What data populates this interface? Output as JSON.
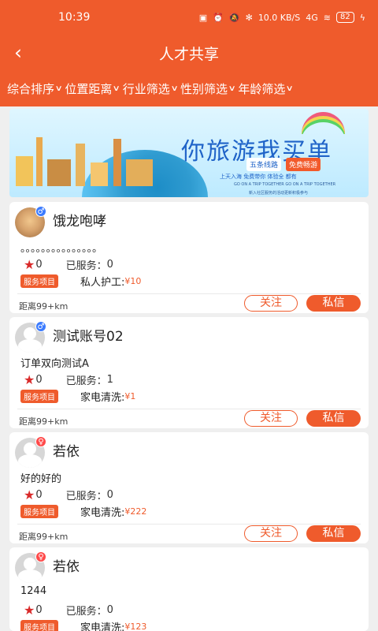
{
  "status_bar": {
    "time": "10:39",
    "network_speed": "10.0 KB/S",
    "signal": "4G",
    "battery": "82"
  },
  "header": {
    "title": "人才共享",
    "back_icon": "chevron-left-icon"
  },
  "filters": [
    {
      "label": "综合排序"
    },
    {
      "label": "位置距离"
    },
    {
      "label": "行业筛选"
    },
    {
      "label": "性别筛选"
    },
    {
      "label": "年龄筛选"
    }
  ],
  "banner": {
    "headline": "你旅游我买单",
    "tag1": "五条线路",
    "tag2": "免费畅游",
    "subline": "上天入海 免费带你 体验全 都有",
    "small_line": "GO ON A TRIP TOGETHER GO ON A TRIP TOGETHER",
    "tiny_line": "新入社区服务的活动更新积极参与"
  },
  "cards": [
    {
      "name": "饿龙咆哮",
      "gender": "male",
      "gender_symbol": "♂",
      "intro": "。。。。。。。。。。。。。。。",
      "rating": "0",
      "served_label": "已服务：",
      "served": "0",
      "service_tag": "服务项目",
      "service_name": "私人护工:",
      "price": "¥10",
      "distance": "距离99+km",
      "follow_label": "关注",
      "message_label": "私信",
      "avatar": "dog"
    },
    {
      "name": "测试账号02",
      "gender": "male",
      "gender_symbol": "♂",
      "intro": "订单双向测试A",
      "rating": "0",
      "served_label": "已服务：",
      "served": "1",
      "service_tag": "服务项目",
      "service_name": "家电清洗:",
      "price": "¥1",
      "distance": "距离99+km",
      "follow_label": "关注",
      "message_label": "私信",
      "avatar": "default"
    },
    {
      "name": "若依",
      "gender": "female",
      "gender_symbol": "♀",
      "intro": "好的好的",
      "rating": "0",
      "served_label": "已服务：",
      "served": "0",
      "service_tag": "服务项目",
      "service_name": "家电清洗:",
      "price": "¥222",
      "distance": "距离99+km",
      "follow_label": "关注",
      "message_label": "私信",
      "avatar": "default"
    },
    {
      "name": "若依",
      "gender": "female",
      "gender_symbol": "♀",
      "intro": "1244",
      "rating": "0",
      "served_label": "已服务：",
      "served": "0",
      "service_tag": "服务项目",
      "service_name": "家电清洗:",
      "price": "¥123",
      "avatar": "default"
    }
  ]
}
